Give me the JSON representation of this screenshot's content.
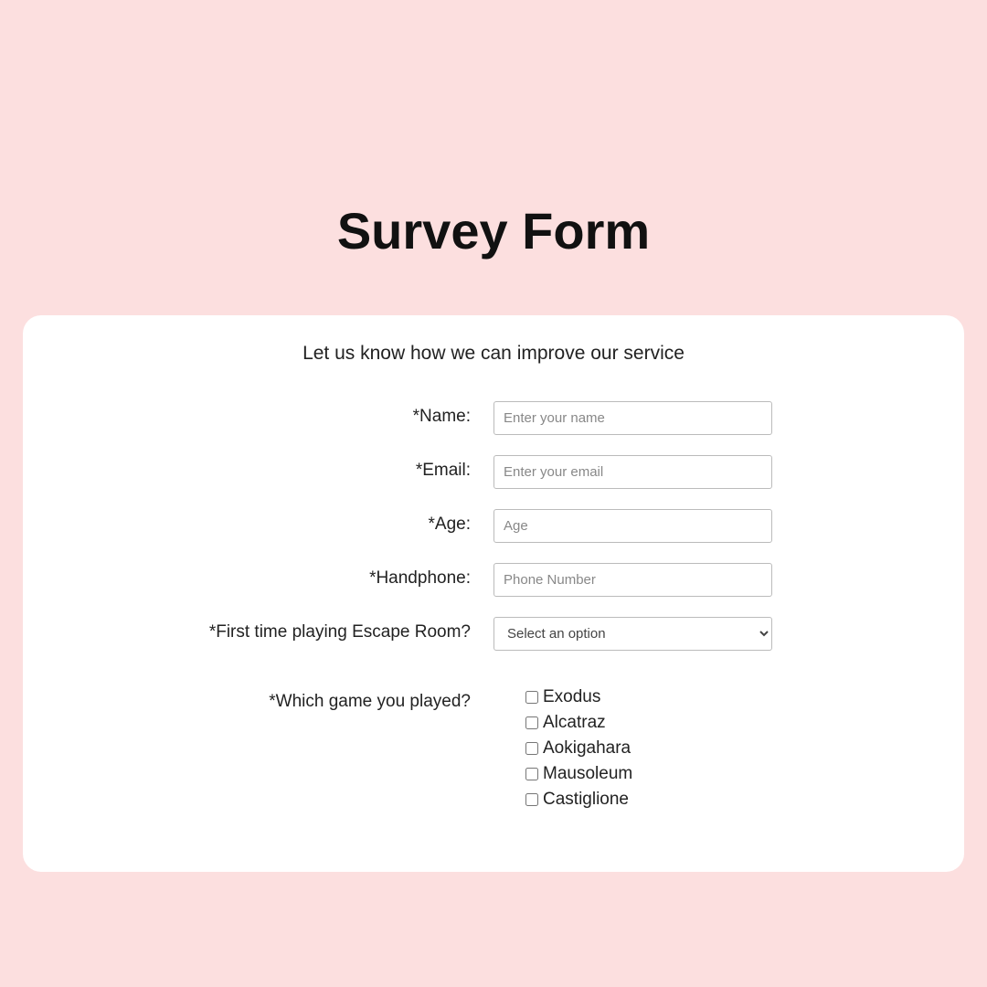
{
  "title": "Survey Form",
  "description": "Let us know how we can improve our service",
  "fields": {
    "name": {
      "label": "*Name:",
      "placeholder": "Enter your name"
    },
    "email": {
      "label": "*Email:",
      "placeholder": "Enter your email"
    },
    "age": {
      "label": "*Age:",
      "placeholder": "Age"
    },
    "handphone": {
      "label": "*Handphone:",
      "placeholder": "Phone Number"
    },
    "firstTime": {
      "label": "*First time playing Escape Room?",
      "selected": "Select an option"
    },
    "games": {
      "label": "*Which game you played?",
      "options": [
        "Exodus",
        "Alcatraz",
        "Aokigahara",
        "Mausoleum",
        "Castiglione"
      ]
    }
  }
}
